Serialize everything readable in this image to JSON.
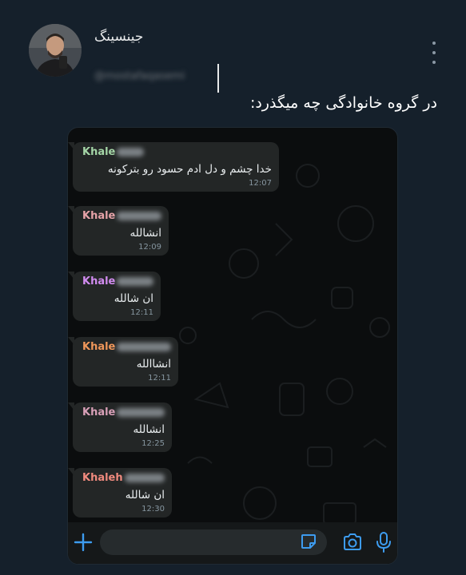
{
  "tweet": {
    "author_name": "جینسینگ",
    "author_handle": "@mostafaqasemi",
    "text": "در گروه خانوادگی چه میگذرد:",
    "more_icon": "more-vertical-icon"
  },
  "chat": {
    "messages": [
      {
        "sender": "Khale",
        "sender_color": "#a5d6a7",
        "text": "خدا چشم و دل ادم حسود رو بترکونه",
        "time": "12:07"
      },
      {
        "sender": "Khale",
        "sender_color": "#e6a3a8",
        "text": "انشالله",
        "time": "12:09"
      },
      {
        "sender": "Khale",
        "sender_color": "#d28cf0",
        "text": "ان شالله",
        "time": "12:11"
      },
      {
        "sender": "Khale",
        "sender_color": "#f0975a",
        "text": "انشاالله",
        "time": "12:11"
      },
      {
        "sender": "Khale",
        "sender_color": "#d9a0b8",
        "text": "انشالله",
        "time": "12:25"
      },
      {
        "sender": "Khaleh",
        "sender_color": "#f08a7e",
        "text": "ان شالله",
        "time": "12:30"
      }
    ],
    "composer_icons": [
      "plus-icon",
      "sticker-icon",
      "camera-icon",
      "mic-icon"
    ]
  }
}
